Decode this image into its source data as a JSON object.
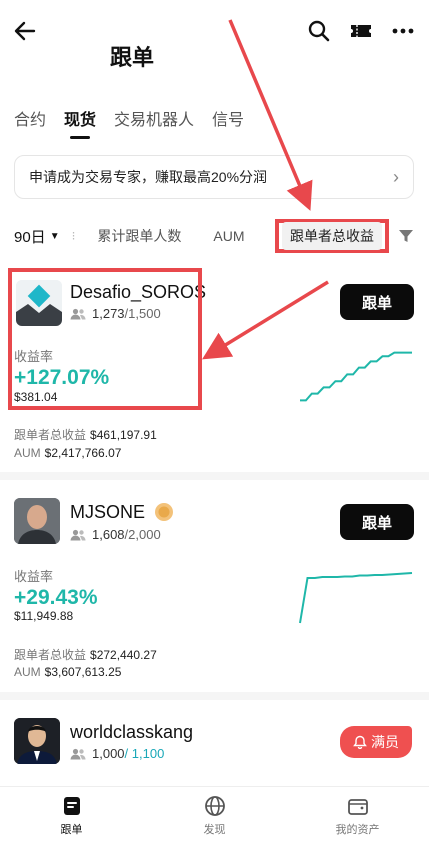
{
  "header": {
    "title": "跟单",
    "icons": [
      "back-arrow-icon",
      "search-icon",
      "ticket-icon",
      "more-icon"
    ]
  },
  "tabs": [
    {
      "label": "合约",
      "active": false
    },
    {
      "label": "现货",
      "active": true
    },
    {
      "label": "交易机器人",
      "active": false
    },
    {
      "label": "信号",
      "active": false
    }
  ],
  "banner": {
    "text": "申请成为交易专家，赚取最高20%分润"
  },
  "filters": {
    "period": "90日",
    "items": [
      "累计跟单人数",
      "AUM"
    ],
    "selected": "跟单者总收益"
  },
  "traders": [
    {
      "name": "Desafio_SOROS",
      "followers": "1,273",
      "capacity": "/1,500",
      "follow_label": "跟单",
      "roi_label": "收益率",
      "roi": "+127.07%",
      "pnl": "$381.04",
      "copier_label": "跟单者总收益",
      "copier_value": "$461,197.91",
      "aum_label": "AUM",
      "aum_value": "$2,417,766.07",
      "trend": [
        0.05,
        0.05,
        0.18,
        0.18,
        0.3,
        0.3,
        0.42,
        0.42,
        0.55,
        0.55,
        0.68,
        0.68,
        0.8,
        0.8,
        0.9,
        0.9,
        0.97,
        0.97,
        0.97,
        0.97
      ]
    },
    {
      "name": "MJSONE",
      "followers": "1,608",
      "capacity": "/2,000",
      "follow_label": "跟单",
      "roi_label": "收益率",
      "roi": "+29.43%",
      "pnl": "$11,949.88",
      "copier_label": "跟单者总收益",
      "copier_value": "$272,440.27",
      "aum_label": "AUM",
      "aum_value": "$3,607,613.25",
      "trend": [
        0.0,
        0.9,
        0.9,
        0.92,
        0.92,
        0.92,
        0.93,
        0.93,
        0.95,
        0.95,
        0.96,
        0.96,
        0.97,
        0.98,
        0.99,
        1.0
      ]
    },
    {
      "name": "worldclasskang",
      "followers": "1,000",
      "capacity": "/ 1,100",
      "full_label": "满员"
    }
  ],
  "bottom_nav": [
    {
      "label": "跟单",
      "icon": "copy-trade-icon",
      "active": true
    },
    {
      "label": "发现",
      "icon": "globe-icon",
      "active": false
    },
    {
      "label": "我的资产",
      "icon": "wallet-icon",
      "active": false
    }
  ],
  "colors": {
    "accent": "#1fb7a9",
    "annotation": "#e8484c",
    "button": "#0b0b0b",
    "full_badge": "#ef5050"
  }
}
